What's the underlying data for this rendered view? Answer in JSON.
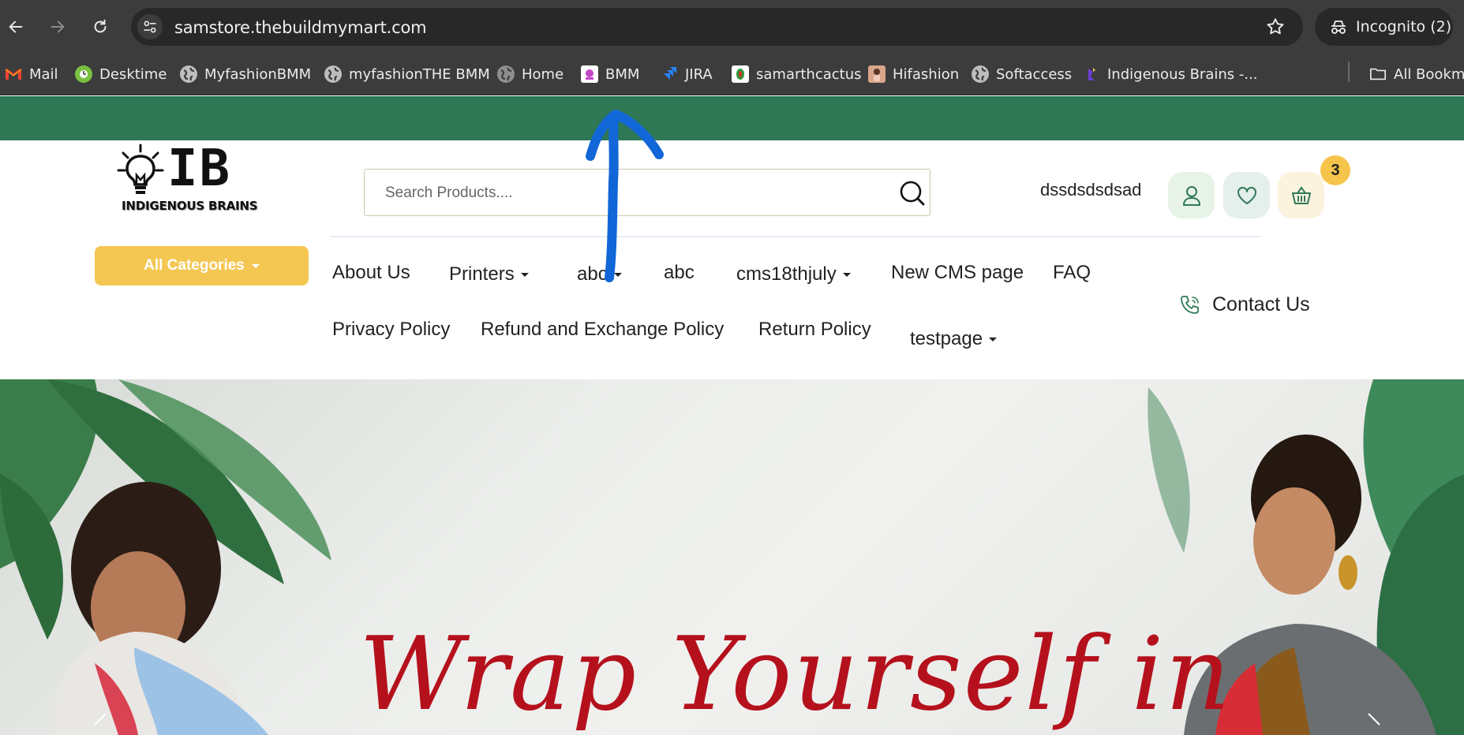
{
  "browser": {
    "url": "samstore.thebuildmymart.com",
    "incognito_label": "Incognito (2)",
    "bookmarks": [
      {
        "label": "Mail",
        "icon": "gmail-icon"
      },
      {
        "label": "Desktime",
        "icon": "desktime-icon"
      },
      {
        "label": "MyfashionBMM",
        "icon": "globe-icon"
      },
      {
        "label": "myfashionTHE BMM",
        "icon": "globe-icon"
      },
      {
        "label": "Home",
        "icon": "globe-icon"
      },
      {
        "label": "BMM",
        "icon": "bmm-icon"
      },
      {
        "label": "JIRA",
        "icon": "jira-icon"
      },
      {
        "label": "samarthcactus",
        "icon": "cactus-icon"
      },
      {
        "label": "Hifashion",
        "icon": "hifashion-icon"
      },
      {
        "label": "Softaccess",
        "icon": "globe-icon"
      },
      {
        "label": "Indigenous Brains -...",
        "icon": "indigenous-brains-icon"
      }
    ],
    "all_bookmarks_label": "All Bookma"
  },
  "header": {
    "logo": {
      "letters": "IB",
      "text": "INDIGENOUS BRAINS"
    },
    "search": {
      "placeholder": "Search Products...."
    },
    "username": "dssdsdsdsad",
    "cart_count": "3"
  },
  "nav": {
    "all_categories": "All Categories",
    "items": [
      {
        "label": "About Us",
        "dropdown": false
      },
      {
        "label": "Printers",
        "dropdown": true
      },
      {
        "label": "abc",
        "dropdown": true
      },
      {
        "label": "abc",
        "dropdown": false
      },
      {
        "label": "cms18thjuly",
        "dropdown": true
      },
      {
        "label": "New CMS page",
        "dropdown": false
      },
      {
        "label": "FAQ",
        "dropdown": false
      },
      {
        "label": "Privacy Policy",
        "dropdown": false
      },
      {
        "label": "Refund and Exchange Policy",
        "dropdown": false
      },
      {
        "label": "Return Policy",
        "dropdown": false
      },
      {
        "label": "testpage",
        "dropdown": true
      }
    ],
    "contact": "Contact Us"
  },
  "hero": {
    "title": "Wrap Yourself in"
  },
  "colors": {
    "topbar": "#2e7856",
    "accent_yellow": "#f4c753",
    "hero_title": "#b5111d",
    "annotation": "#1166d8"
  }
}
